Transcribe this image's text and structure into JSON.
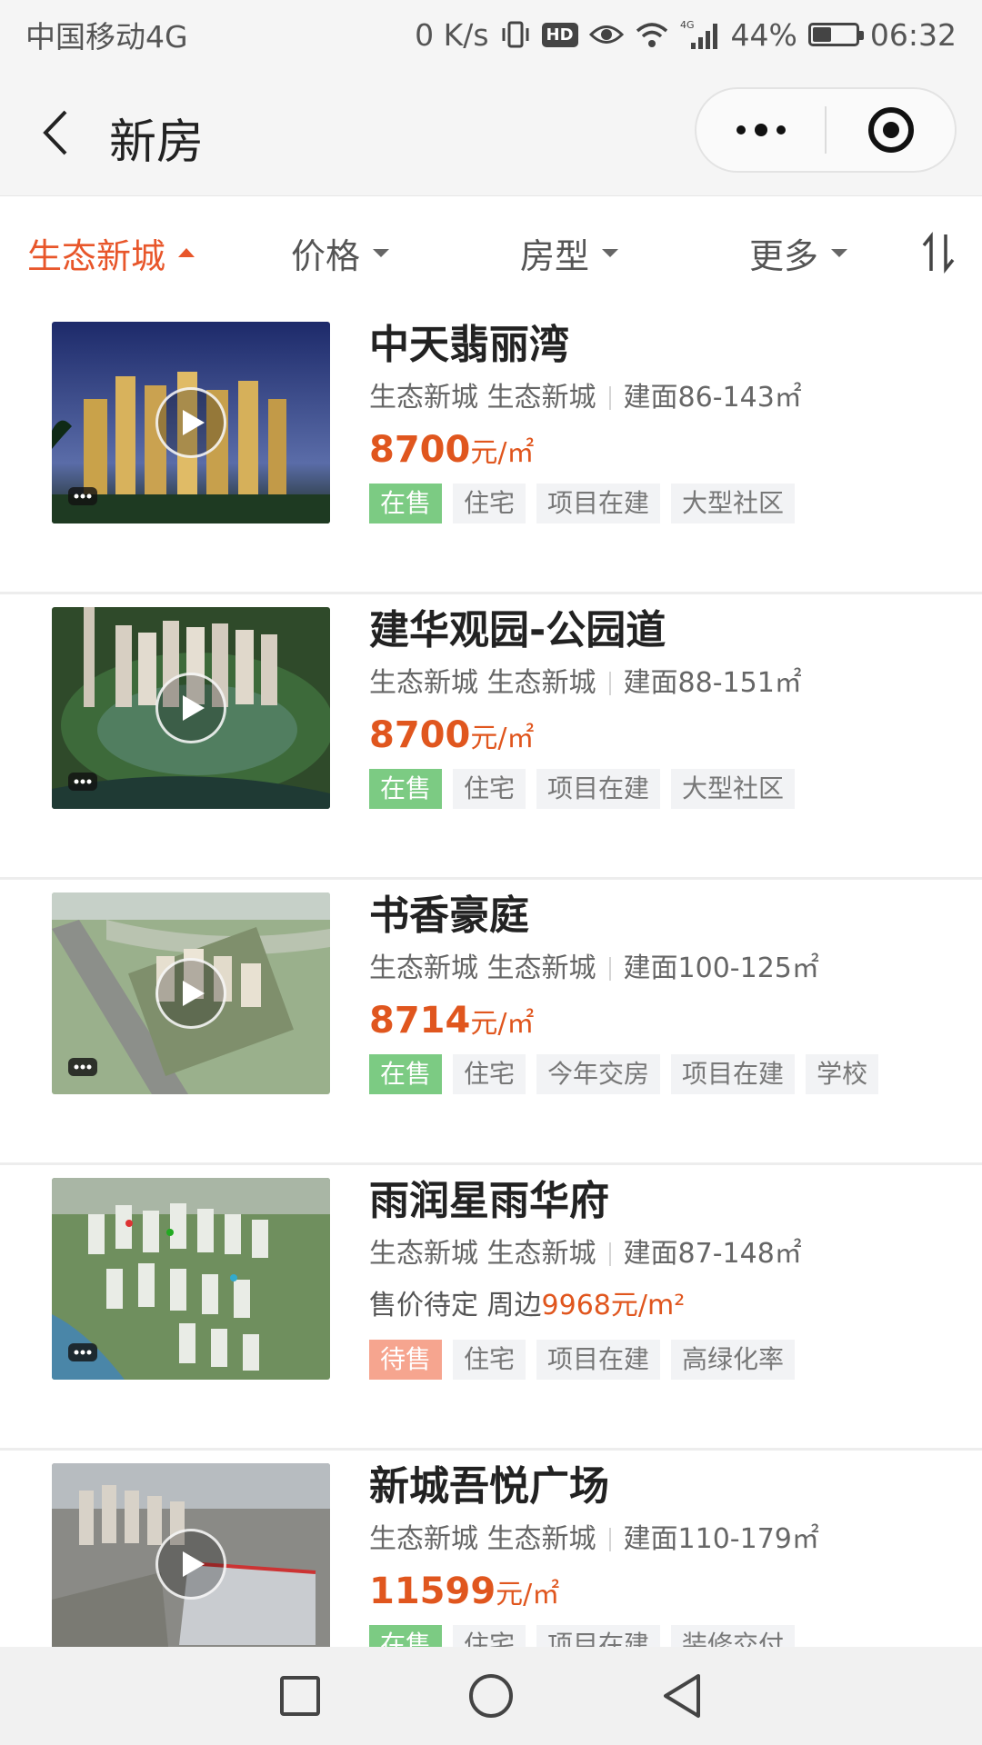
{
  "status_bar": {
    "carrier": "中国移动4G",
    "speed": "0 K/s",
    "hd": "HD",
    "network": "4G",
    "battery_level": 0.44,
    "battery_text": "44%",
    "time": "06:32"
  },
  "header": {
    "title": "新房"
  },
  "filters": {
    "items": [
      {
        "label": "生态新城",
        "active": true
      },
      {
        "label": "价格",
        "active": false
      },
      {
        "label": "房型",
        "active": false
      },
      {
        "label": "更多",
        "active": false
      }
    ]
  },
  "listings": [
    {
      "name": "中天翡丽湾",
      "district": "生态新城 生态新城",
      "area": "建面86-143㎡",
      "price": "8700",
      "unit": "元/㎡",
      "tags": [
        "在售",
        "住宅",
        "项目在建",
        "大型社区"
      ]
    },
    {
      "name": "建华观园-公园道",
      "district": "生态新城 生态新城",
      "area": "建面88-151㎡",
      "price": "8700",
      "unit": "元/㎡",
      "tags": [
        "在售",
        "住宅",
        "项目在建",
        "大型社区"
      ]
    },
    {
      "name": "书香豪庭",
      "district": "生态新城 生态新城",
      "area": "建面100-125㎡",
      "price": "8714",
      "unit": "元/㎡",
      "tags": [
        "在售",
        "住宅",
        "今年交房",
        "项目在建",
        "学校"
      ]
    },
    {
      "name": "雨润星雨华府",
      "district": "生态新城 生态新城",
      "area": "建面87-148㎡",
      "price_note": "售价待定 周边",
      "price_nearby": "9968元/m²",
      "tags": [
        "待售",
        "住宅",
        "项目在建",
        "高绿化率"
      ]
    },
    {
      "name": "新城吾悦广场",
      "district": "生态新城 生态新城",
      "area": "建面110-179㎡",
      "price": "11599",
      "unit": "元/㎡",
      "tags": [
        "在售",
        "住宅",
        "项目在建",
        "装修交付"
      ]
    }
  ],
  "colors": {
    "accent": "#e8562a",
    "price": "#e0561e",
    "on_sale": "#7ccb83",
    "pending": "#f6a58f"
  }
}
